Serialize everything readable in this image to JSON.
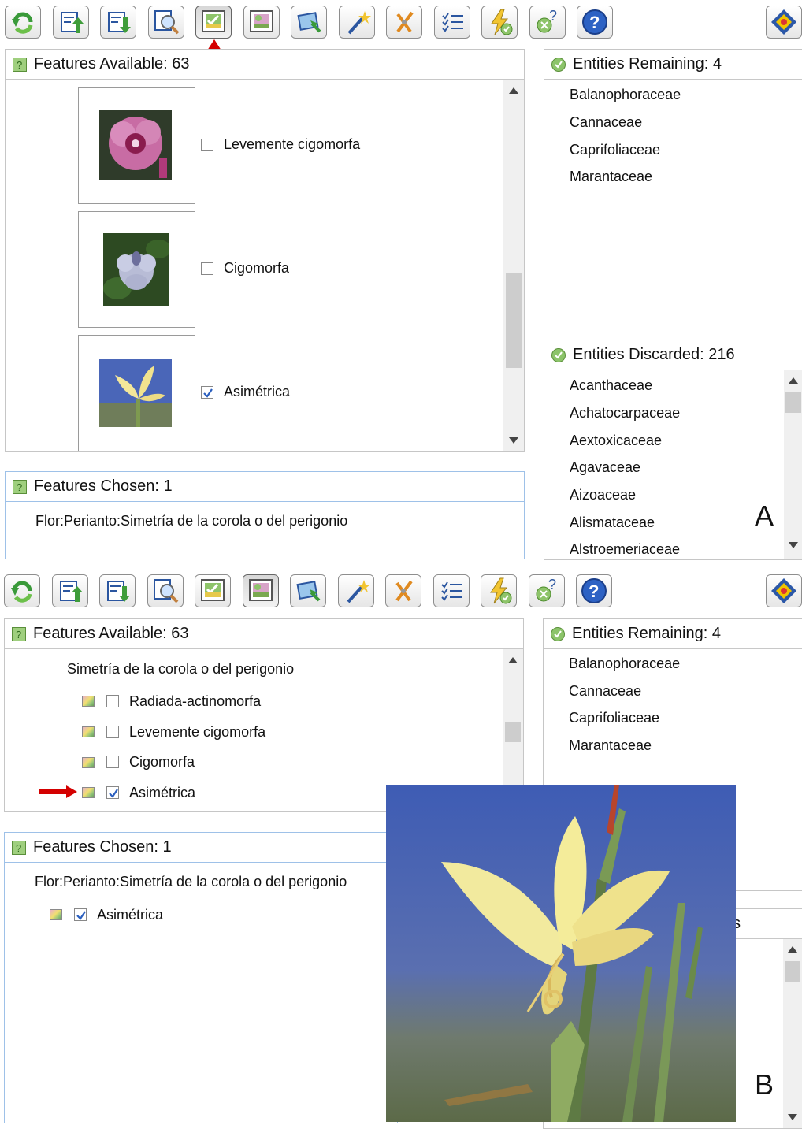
{
  "toolbar_icons": [
    "restart-icon",
    "upload-features-icon",
    "download-features-icon",
    "search-icon",
    "image-view-icon",
    "image-view-alt-icon",
    "select-entity-icon",
    "magic-wand-icon",
    "scissors-icon",
    "checklist-icon",
    "lightning-check-icon",
    "remove-help-icon",
    "help-icon",
    "logo-icon"
  ],
  "colors": {
    "accent_blue": "#9ec1e8",
    "check_blue": "#2a5fbf",
    "arrow_red": "#d40000",
    "header_icon_green": "#5aa03c"
  },
  "panel_a": {
    "label": "A",
    "features_available": {
      "title": "Features Available: 63",
      "items": [
        {
          "label": "Levemente cigomorfa",
          "checked": false
        },
        {
          "label": "Cigomorfa",
          "checked": false
        },
        {
          "label": "Asimétrica",
          "checked": true
        }
      ]
    },
    "features_chosen": {
      "title": "Features Chosen: 1",
      "path": "Flor:Perianto:Simetría de la corola o del perigonio"
    },
    "entities_remaining": {
      "title": "Entities Remaining: 4",
      "items": [
        "Balanophoraceae",
        "Cannaceae",
        "Caprifoliaceae",
        "Marantaceae"
      ]
    },
    "entities_discarded": {
      "title": "Entities Discarded: 216",
      "items": [
        "Acanthaceae",
        "Achatocarpaceae",
        "Aextoxicaceae",
        "Agavaceae",
        "Aizoaceae",
        "Alismataceae",
        "Alstroemeriaceae"
      ]
    }
  },
  "panel_b": {
    "label": "B",
    "features_available": {
      "title": "Features Available: 63",
      "group": "Simetría de la corola o del perigonio",
      "items": [
        {
          "label": "Radiada-actinomorfa",
          "checked": false
        },
        {
          "label": "Levemente cigomorfa",
          "checked": false
        },
        {
          "label": "Cigomorfa",
          "checked": false
        },
        {
          "label": "Asimétrica",
          "checked": true
        }
      ]
    },
    "features_chosen": {
      "title": "Features Chosen: 1",
      "path": "Flor:Perianto:Simetría de la corola o del perigonio",
      "selected": "Asimétrica"
    },
    "entities_remaining": {
      "title": "Entities Remaining: 4",
      "items": [
        "Balanophoraceae",
        "Cannaceae",
        "Caprifoliaceae",
        "Marantaceae"
      ]
    },
    "entities_discarded": {
      "title_fragment": "s"
    }
  }
}
